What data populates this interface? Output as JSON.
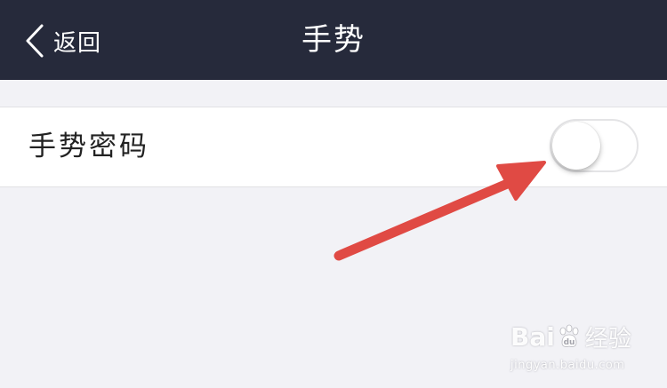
{
  "navbar": {
    "back_label": "返回",
    "title": "手势"
  },
  "settings": {
    "rows": [
      {
        "label": "手势密码",
        "toggle_on": false
      }
    ]
  },
  "watermark": {
    "brand_left": "Bai",
    "brand_right": "经验",
    "url": "jingyan.baidu.com"
  },
  "colors": {
    "navbar_bg": "#262a3b",
    "page_bg": "#f2f2f6",
    "arrow": "#e04a44"
  }
}
